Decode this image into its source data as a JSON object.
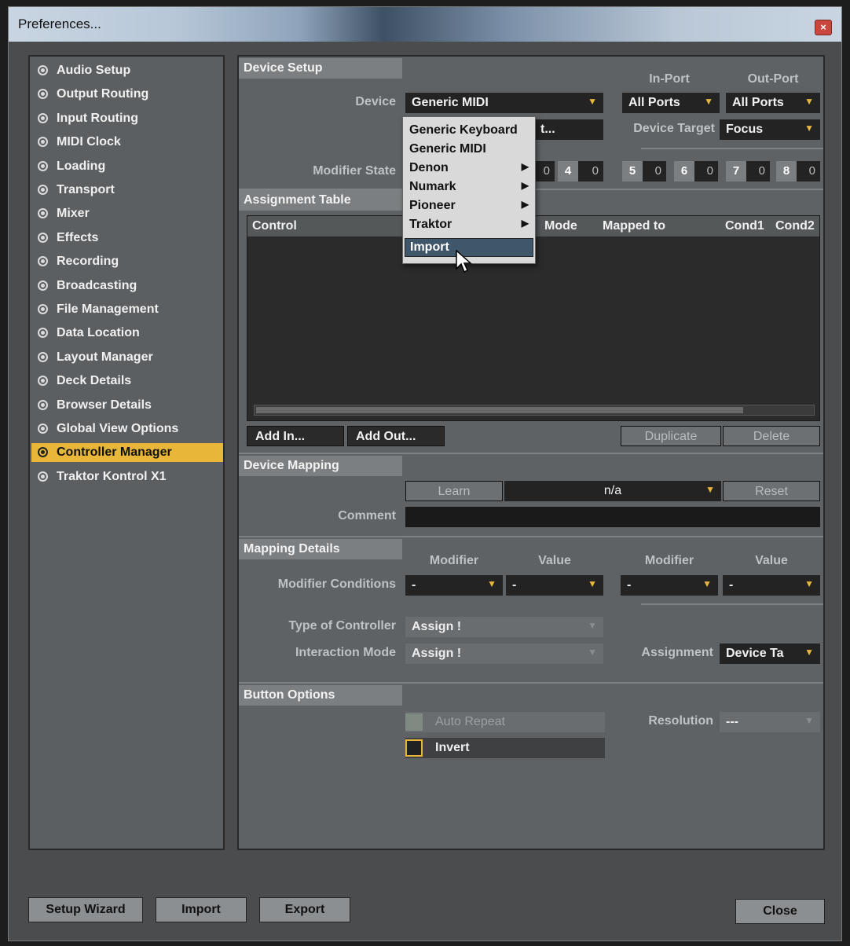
{
  "window": {
    "title": "Preferences...",
    "close_glyph": "×"
  },
  "sidebar": {
    "items": [
      {
        "label": "Audio Setup"
      },
      {
        "label": "Output Routing"
      },
      {
        "label": "Input Routing"
      },
      {
        "label": "MIDI Clock"
      },
      {
        "label": "Loading"
      },
      {
        "label": "Transport"
      },
      {
        "label": "Mixer"
      },
      {
        "label": "Effects"
      },
      {
        "label": "Recording"
      },
      {
        "label": "Broadcasting"
      },
      {
        "label": "File Management"
      },
      {
        "label": "Data Location"
      },
      {
        "label": "Layout Manager"
      },
      {
        "label": "Deck Details"
      },
      {
        "label": "Browser Details"
      },
      {
        "label": "Global View Options"
      },
      {
        "label": "Controller Manager",
        "active": true
      },
      {
        "label": "Traktor Kontrol X1"
      }
    ]
  },
  "device_setup": {
    "title": "Device Setup",
    "in_port_header": "In-Port",
    "out_port_header": "Out-Port",
    "device_label": "Device",
    "device_value": "Generic MIDI",
    "in_port_value": "All Ports",
    "out_port_value": "All Ports",
    "device_hidden_value": "t...",
    "device_target_label": "Device Target",
    "device_target_value": "Focus",
    "modifier_state_label": "Modifier State",
    "modifiers": [
      {
        "n": "4",
        "v": "0"
      },
      {
        "n": "5",
        "v": "0"
      },
      {
        "n": "6",
        "v": "0"
      },
      {
        "n": "7",
        "v": "0"
      },
      {
        "n": "8",
        "v": "0"
      }
    ],
    "partial_modifier_value": "0"
  },
  "assignment_table": {
    "title": "Assignment Table",
    "columns": [
      "Control",
      "Mode",
      "Mapped to",
      "Cond1",
      "Cond2"
    ],
    "add_in": "Add In...",
    "add_out": "Add Out...",
    "duplicate": "Duplicate",
    "delete": "Delete"
  },
  "device_mapping": {
    "title": "Device Mapping",
    "learn": "Learn",
    "mapping_value": "n/a",
    "reset": "Reset",
    "comment_label": "Comment",
    "comment_value": ""
  },
  "mapping_details": {
    "title": "Mapping Details",
    "modifier_header": "Modifier",
    "value_header": "Value",
    "modifier_conditions_label": "Modifier Conditions",
    "cond_values": [
      "-",
      "-",
      "-",
      "-"
    ],
    "type_of_controller_label": "Type of Controller",
    "type_of_controller_value": "Assign !",
    "interaction_mode_label": "Interaction Mode",
    "interaction_mode_value": "Assign !",
    "assignment_label": "Assignment",
    "assignment_value": "Device Ta"
  },
  "button_options": {
    "title": "Button Options",
    "auto_repeat": "Auto Repeat",
    "invert": "Invert",
    "resolution_label": "Resolution",
    "resolution_value": "---"
  },
  "device_menu": {
    "items": [
      {
        "label": "Generic Keyboard",
        "submenu": false
      },
      {
        "label": "Generic MIDI",
        "submenu": false
      },
      {
        "label": "Denon",
        "submenu": true
      },
      {
        "label": "Numark",
        "submenu": true
      },
      {
        "label": "Pioneer",
        "submenu": true
      },
      {
        "label": "Traktor",
        "submenu": true
      },
      {
        "label": "Import",
        "submenu": false,
        "highlighted": true
      }
    ],
    "submenu_glyph": "▶"
  },
  "footer": {
    "setup_wizard": "Setup Wizard",
    "import": "Import",
    "export": "Export",
    "close": "Close"
  },
  "colors": {
    "accent": "#e8b73a",
    "panel": "#5f6264",
    "field": "#232323"
  }
}
